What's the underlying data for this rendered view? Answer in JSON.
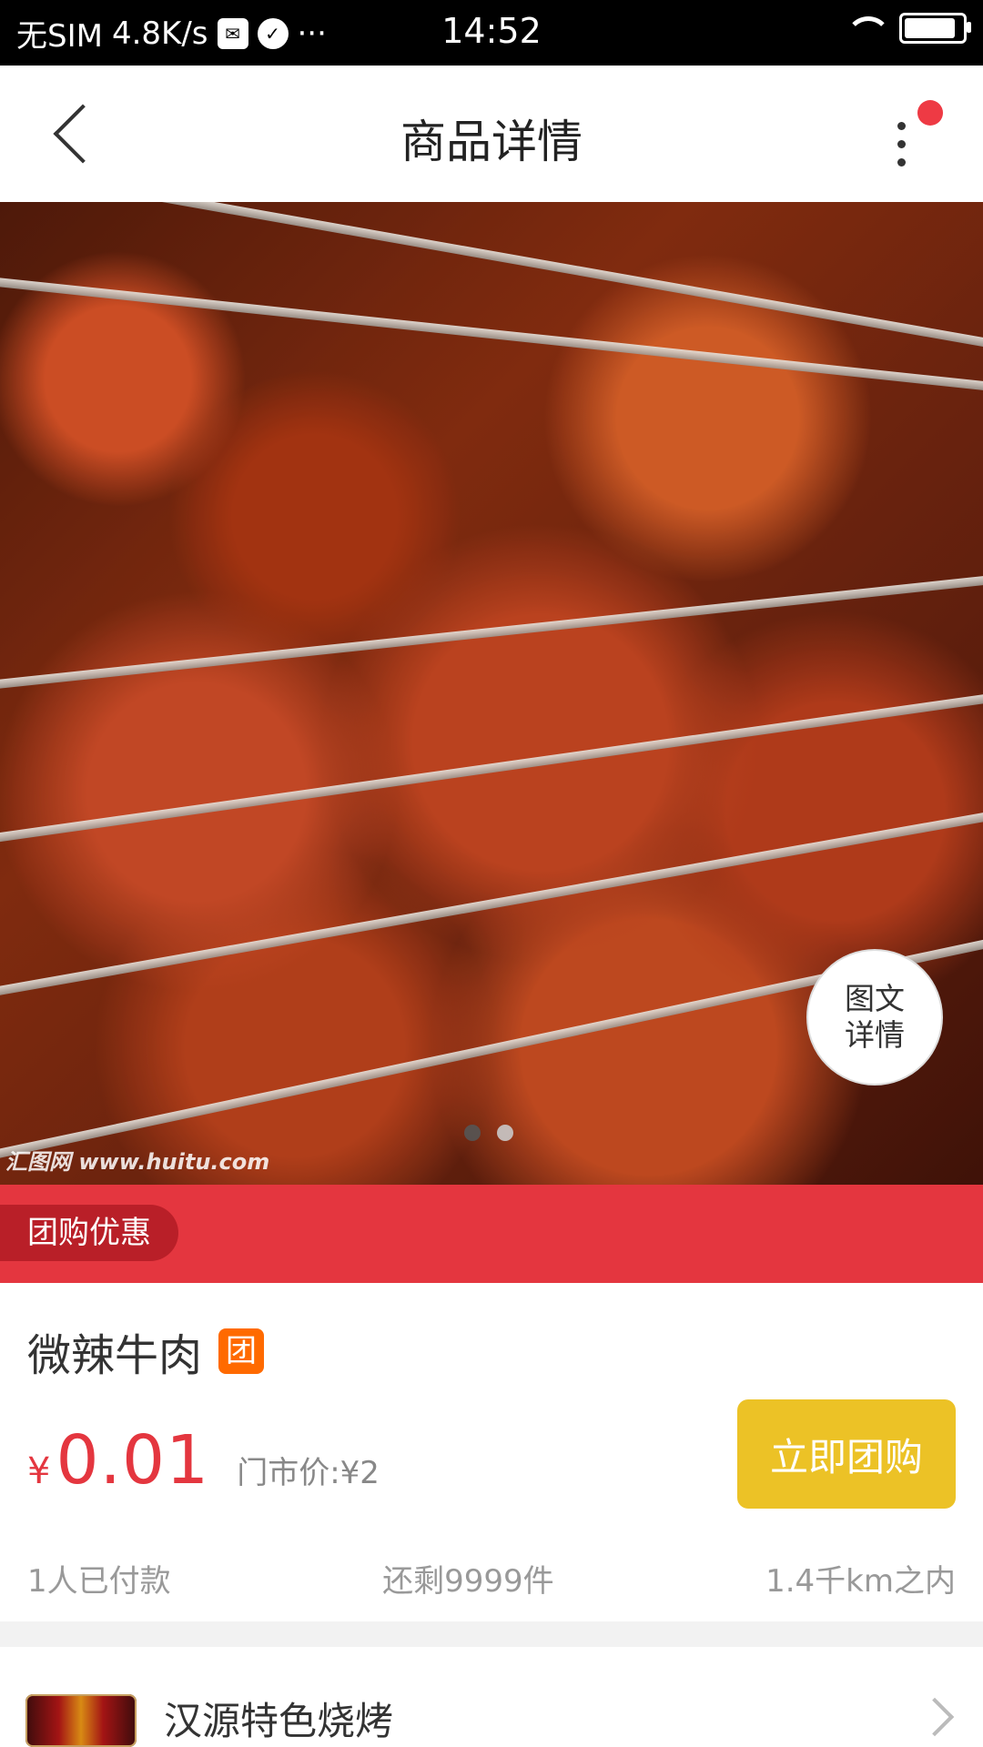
{
  "status_bar": {
    "carrier": "无SIM",
    "speed": "4.8K/s",
    "dots": "···",
    "time": "14:52"
  },
  "nav": {
    "title": "商品详情"
  },
  "hero": {
    "watermark": "汇图网 www.huitu.com",
    "detail_button": "图文\n详情",
    "pager_active_index": 0,
    "pager_count": 2
  },
  "promo": {
    "tag": "团购优惠",
    "accent": "#e4363f"
  },
  "product": {
    "name": "微辣牛肉",
    "badge": "团",
    "currency": "¥",
    "price": "0.01",
    "original_price": "门市价:¥2",
    "buy_label": "立即团购",
    "paid_count": "1人已付款",
    "remaining": "还剩9999件",
    "distance": "1.4千km之内"
  },
  "store": {
    "name": "汉源特色烧烤"
  },
  "icons": {
    "back": "back-icon",
    "more": "more-icon",
    "notification_dot": "notification-dot",
    "chevron": "chevron-right-icon"
  }
}
